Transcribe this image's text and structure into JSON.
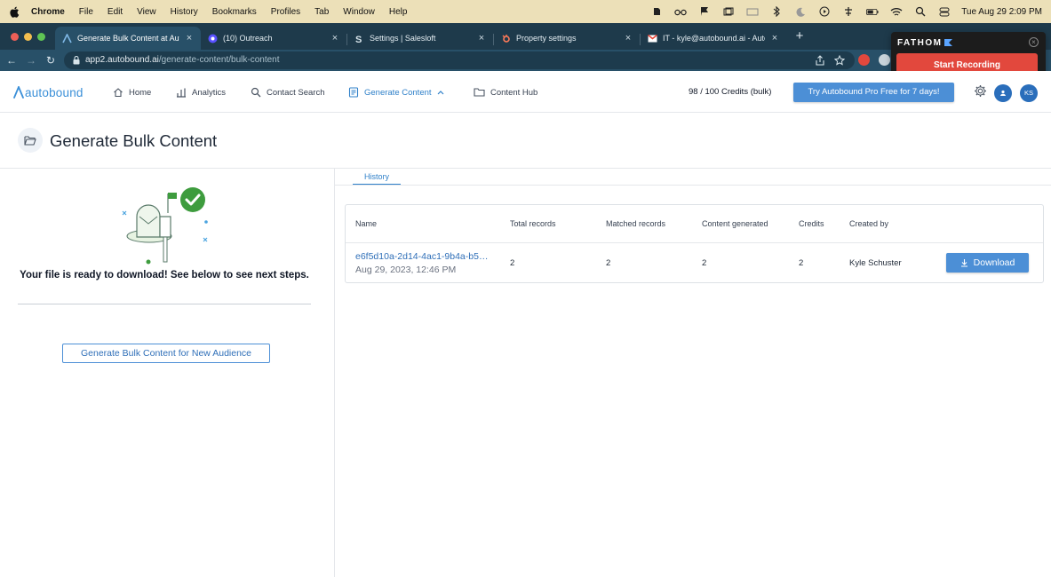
{
  "menubar": {
    "app": "Chrome",
    "items": [
      "File",
      "Edit",
      "View",
      "History",
      "Bookmarks",
      "Profiles",
      "Tab",
      "Window",
      "Help"
    ],
    "clock": "Tue Aug 29  2:09 PM"
  },
  "tabs": [
    {
      "label": "Generate Bulk Content at Autob",
      "icon": "autobound-icon",
      "active": true
    },
    {
      "label": "(10) Outreach",
      "icon": "outreach-icon",
      "active": false
    },
    {
      "label": "Settings | Salesloft",
      "icon": "salesloft-icon",
      "active": false
    },
    {
      "label": "Property settings",
      "icon": "hubspot-icon",
      "active": false
    },
    {
      "label": "IT - kyle@autobound.ai - Autob",
      "icon": "gmail-icon",
      "active": false
    }
  ],
  "address": {
    "host": "app2.autobound.ai",
    "path": "/generate-content/bulk-content"
  },
  "fathom": {
    "brand": "FATHOM",
    "button": "Start Recording",
    "colors": {
      "button": "#e2483d",
      "panel": "#1c1c1c"
    }
  },
  "nav": {
    "logo": "autobound",
    "items": [
      {
        "label": "Home",
        "icon": "home-icon"
      },
      {
        "label": "Analytics",
        "icon": "analytics-icon"
      },
      {
        "label": "Contact Search",
        "icon": "search-icon"
      },
      {
        "label": "Generate Content",
        "icon": "document-icon",
        "active": true
      },
      {
        "label": "Content Hub",
        "icon": "folder-icon"
      }
    ],
    "credits": "98 / 100 Credits (bulk)",
    "try_button": "Try Autobound Pro Free for 7 days!",
    "avatar_initials": "KS",
    "accent": "#2f80c9"
  },
  "page": {
    "title": "Generate Bulk Content"
  },
  "left": {
    "message": "Your file is ready to download! See below to see next steps.",
    "new_audience_button": "Generate Bulk Content for New Audience"
  },
  "history": {
    "tab_label": "History",
    "columns": [
      "Name",
      "Total records",
      "Matched records",
      "Content generated",
      "Credits",
      "Created by"
    ],
    "rows": [
      {
        "name": "e6f5d10a-2d14-4ac1-9b4a-b5…",
        "date": "Aug 29, 2023, 12:46 PM",
        "total_records": "2",
        "matched_records": "2",
        "content_generated": "2",
        "credits": "2",
        "created_by": "Kyle Schuster",
        "action": "Download"
      }
    ]
  }
}
